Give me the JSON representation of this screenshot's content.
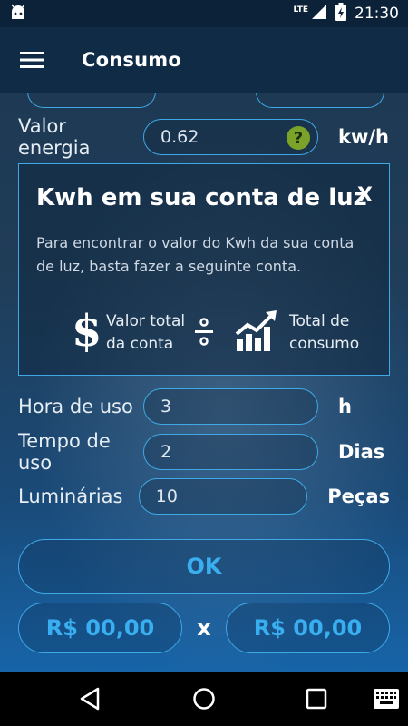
{
  "status": {
    "network": "LTE",
    "time": "21:30"
  },
  "header": {
    "title": "Consumo"
  },
  "energy": {
    "label": "Valor energia",
    "value": "0.62",
    "unit": "kw/h",
    "help": "?"
  },
  "info": {
    "title": "Kwh em sua conta de luz",
    "close": "X",
    "text": "Para encontrar o valor do Kwh da sua conta de luz, basta fazer a seguinte conta.",
    "dollar": "$",
    "left_line1": "Valor total",
    "left_line2": "da conta",
    "right_line1": "Total de",
    "right_line2": "consumo"
  },
  "fields": [
    {
      "label": "Hora de uso",
      "value": "3",
      "unit": "h"
    },
    {
      "label": "Tempo de uso",
      "value": "2",
      "unit": "Dias"
    },
    {
      "label": "Luminárias",
      "value": "10",
      "unit": "Peças"
    }
  ],
  "actions": {
    "ok": "OK",
    "result_left": "R$ 00,00",
    "times": "x",
    "result_right": "R$ 00,00"
  }
}
